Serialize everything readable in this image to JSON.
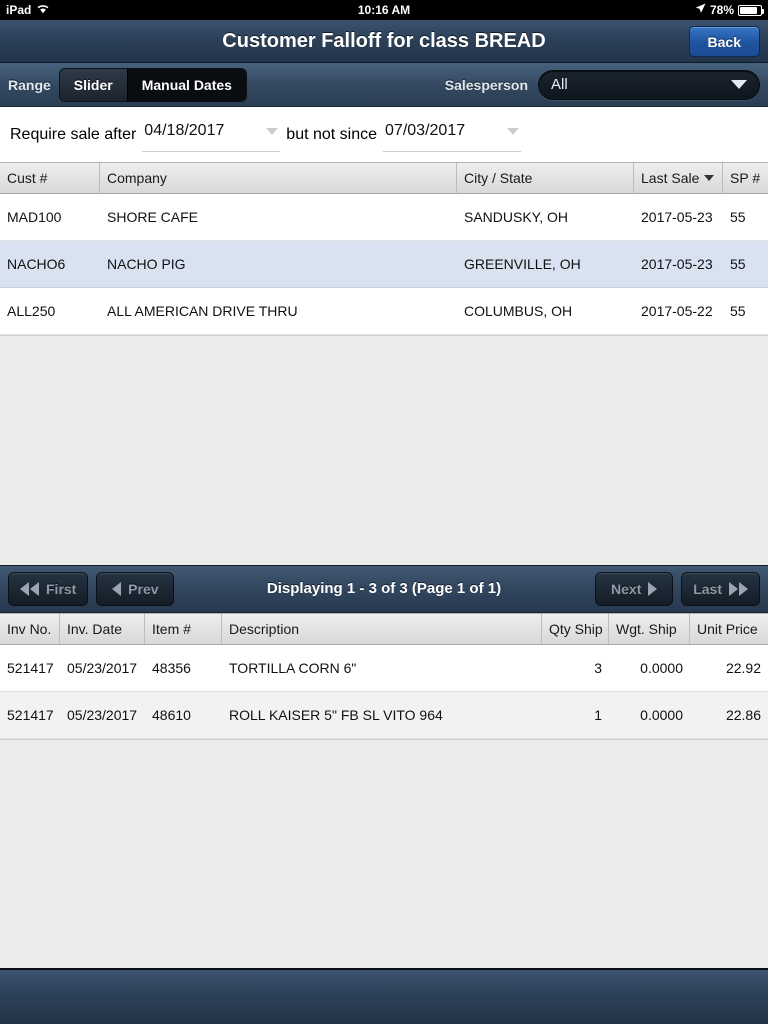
{
  "status_bar": {
    "device": "iPad",
    "wifi_icon": "wifi-icon",
    "time": "10:16 AM",
    "location_icon": "location-arrow-icon",
    "battery_percent": "78%",
    "battery_icon": "battery-icon"
  },
  "navbar": {
    "title": "Customer Falloff for class BREAD",
    "back_label": "Back"
  },
  "toolbar": {
    "range_label": "Range",
    "segments": [
      {
        "label": "Slider",
        "selected": true
      },
      {
        "label": "Manual Dates",
        "selected": false
      }
    ],
    "salesperson_label": "Salesperson",
    "salesperson_value": "All",
    "dropdown_icon": "chevron-down-icon"
  },
  "date_filter": {
    "after_label": "Require sale after",
    "after_value": "04/18/2017",
    "before_label": "but not since",
    "before_value": "07/03/2017",
    "caret_icon": "chevron-down-icon"
  },
  "customer_grid": {
    "columns": [
      "Cust #",
      "Company",
      "City / State",
      "Last Sale",
      "SP #"
    ],
    "sort_column_index": 3,
    "sort_icon": "sort-descending-icon",
    "rows": [
      {
        "cust": "MAD100",
        "company": "SHORE CAFE",
        "city": "SANDUSKY, OH",
        "last_sale": "2017-05-23",
        "sp": "55"
      },
      {
        "cust": "NACHO6",
        "company": "NACHO PIG",
        "city": "GREENVILLE, OH",
        "last_sale": "2017-05-23",
        "sp": "55"
      },
      {
        "cust": "ALL250",
        "company": "ALL AMERICAN DRIVE THRU",
        "city": "COLUMBUS, OH",
        "last_sale": "2017-05-22",
        "sp": "55"
      }
    ]
  },
  "pager": {
    "first_label": "First",
    "prev_label": "Prev",
    "status": "Displaying 1 - 3 of 3 (Page 1 of 1)",
    "next_label": "Next",
    "last_label": "Last",
    "first_icon": "double-chevron-left-icon",
    "prev_icon": "chevron-left-icon",
    "next_icon": "chevron-right-icon",
    "last_icon": "double-chevron-right-icon"
  },
  "detail_grid": {
    "columns": [
      "Inv No.",
      "Inv. Date",
      "Item #",
      "Description",
      "Qty Ship",
      "Wgt. Ship",
      "Unit Price"
    ],
    "rows": [
      {
        "inv_no": "521417",
        "inv_date": "05/23/2017",
        "item": "48356",
        "description": "TORTILLA CORN 6\"",
        "qty": "3",
        "wgt": "0.0000",
        "price": "22.92"
      },
      {
        "inv_no": "521417",
        "inv_date": "05/23/2017",
        "item": "48610",
        "description": "ROLL KAISER 5\" FB SL VITO 964",
        "qty": "1",
        "wgt": "0.0000",
        "price": "22.86"
      }
    ]
  },
  "colors": {
    "navbar": "#2b3f57",
    "accent_button": "#1f539d",
    "selected_row": "#d8e2f0",
    "empty_area": "#ececec",
    "grid_header": "#e0e0e0"
  }
}
